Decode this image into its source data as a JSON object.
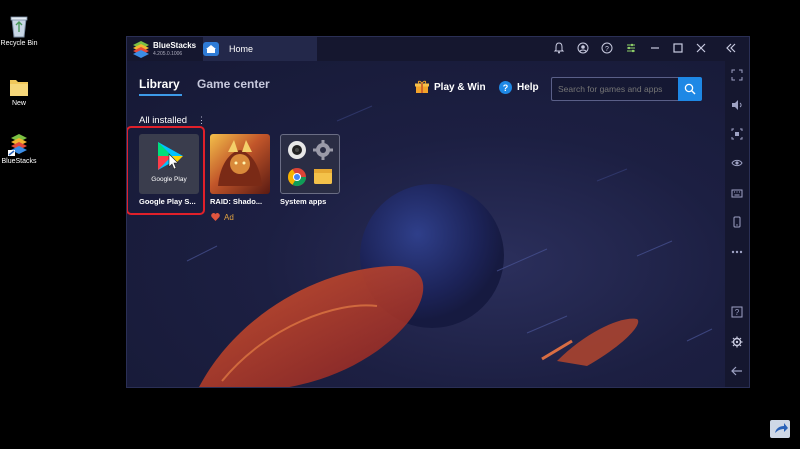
{
  "desktop": {
    "icons": [
      {
        "label": "Recycle Bin"
      },
      {
        "label": "New"
      },
      {
        "label": "BlueStacks"
      }
    ]
  },
  "window": {
    "app_name": "BlueStacks",
    "version": "4.205.0.1006",
    "home_tab": "Home",
    "tabs": [
      "Library",
      "Game center"
    ],
    "play_win": "Play & Win",
    "help": "Help",
    "search_placeholder": "Search for games and apps",
    "section_title": "All installed",
    "apps": [
      {
        "name": "Google Play S...",
        "inner_label": "Google Play",
        "selected": true
      },
      {
        "name": "RAID: Shado...",
        "badge": "Ad"
      },
      {
        "name": "System apps"
      }
    ]
  },
  "colors": {
    "accent": "#1e88e5",
    "tab_underline": "#3d9ae8",
    "highlight_border": "#e0202a",
    "gift": "#f3a32a",
    "heart": "#e0553f",
    "background": "#1a1d3c"
  }
}
